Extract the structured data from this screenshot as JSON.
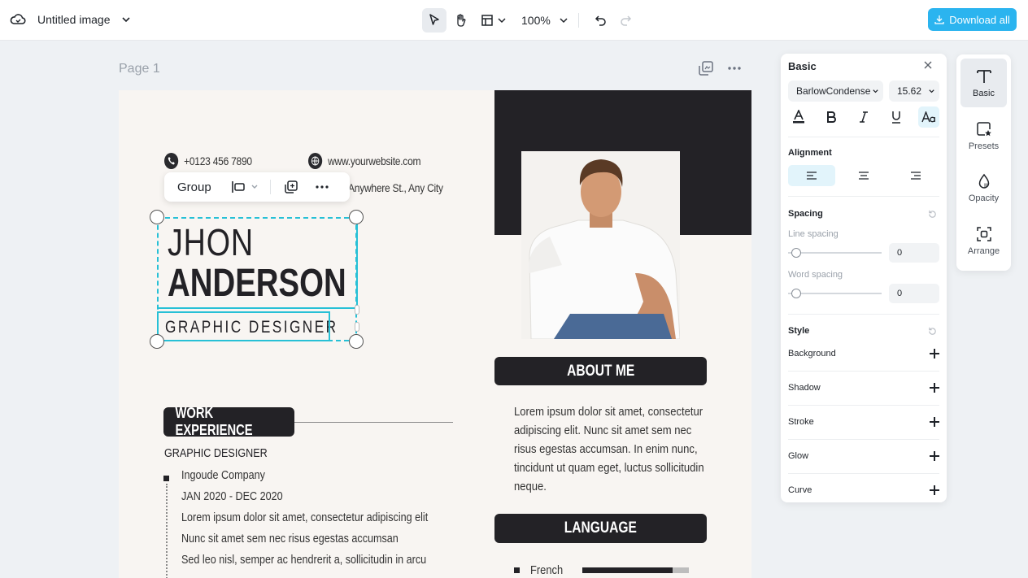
{
  "topbar": {
    "file_title": "Untitled image",
    "zoom": "100%",
    "download_label": "Download all"
  },
  "canvas": {
    "page_label": "Page 1"
  },
  "resume": {
    "phone": "+0123 456 7890",
    "website": "www.yourwebsite.com",
    "address": "Anywhere St., Any City",
    "first_name": "JHON",
    "last_name": "ANDERSON",
    "role": "GRAPHIC DESIGNER",
    "about_heading": "ABOUT ME",
    "about_text": "Lorem ipsum dolor sit amet, consectetur adipiscing elit. Nunc sit amet sem nec risus egestas accumsan. In enim nunc, tincidunt ut quam eget, luctus sollicitudin neque.",
    "work_heading": "WORK EXPERIENCE",
    "job_title": "GRAPHIC DESIGNER",
    "company": "Ingoude Company",
    "period": "JAN 2020 - DEC 2020",
    "line1": "Lorem ipsum dolor sit amet, consectetur adipiscing elit",
    "line2": "Nunc sit amet sem nec risus egestas accumsan",
    "line3": "Sed leo nisl, semper ac hendrerit a, sollicitudin in arcu",
    "language_heading": "LANGUAGE",
    "language_name": "French",
    "language_level": 0.85
  },
  "group_toolbar": {
    "group_label": "Group"
  },
  "panel": {
    "title": "Basic",
    "font_family": "BarlowCondense",
    "font_size": "15.62",
    "alignment_label": "Alignment",
    "spacing_label": "Spacing",
    "line_spacing_label": "Line spacing",
    "line_spacing_value": "0",
    "word_spacing_label": "Word spacing",
    "word_spacing_value": "0",
    "style_label": "Style",
    "style_rows": [
      "Background",
      "Shadow",
      "Stroke",
      "Glow",
      "Curve"
    ]
  },
  "sidebar": {
    "items": [
      {
        "label": "Basic",
        "icon": "text-icon"
      },
      {
        "label": "Presets",
        "icon": "presets-icon"
      },
      {
        "label": "Opacity",
        "icon": "opacity-icon"
      },
      {
        "label": "Arrange",
        "icon": "arrange-icon"
      }
    ]
  },
  "colors": {
    "accent": "#2bb4ef",
    "selection": "#27c0d6",
    "resume_dark": "#232226"
  }
}
